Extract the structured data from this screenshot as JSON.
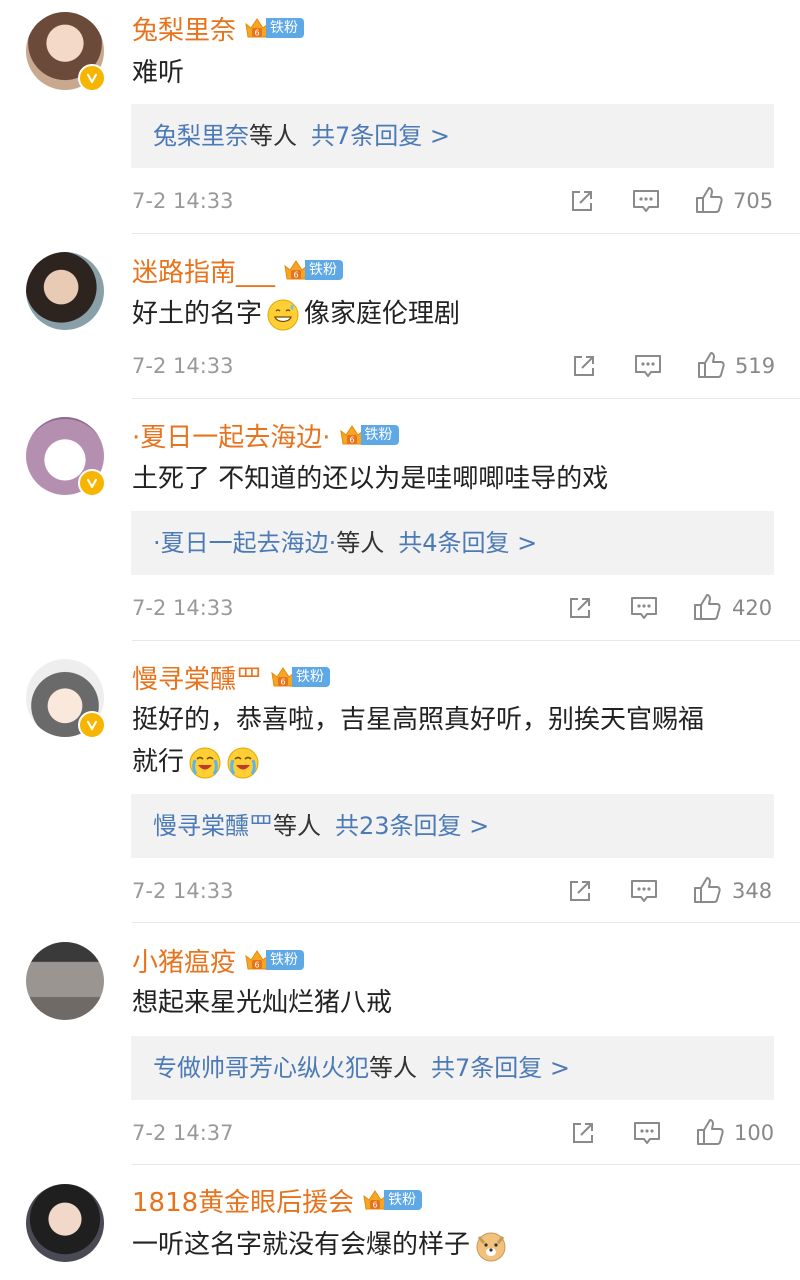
{
  "comments": [
    {
      "user": "兔梨里奈",
      "fan_tag": "铁粉",
      "text": "难听",
      "reply_names": "兔梨里奈",
      "reply_deng": "等人",
      "reply_count": "共7条回复 >",
      "time": "7-2 14:33",
      "likes": "705"
    },
    {
      "user": "迷路指南___",
      "fan_tag": "铁粉",
      "text_a": "好土的名字",
      "text_b": "像家庭伦理剧",
      "time": "7-2 14:33",
      "likes": "519"
    },
    {
      "user": "·夏日一起去海边·",
      "fan_tag": "铁粉",
      "text": "土死了 不知道的还以为是哇唧唧哇导的戏",
      "reply_names": "·夏日一起去海边·",
      "reply_deng": "等人",
      "reply_count": "共4条回复 >",
      "time": "7-2 14:33",
      "likes": "420"
    },
    {
      "user": "慢寻棠醺罒",
      "fan_tag": "铁粉",
      "text_line1": "挺好的，恭喜啦，吉星高照真好听，别挨天官赐福",
      "text_line2": "就行",
      "reply_names": "慢寻棠醺罒",
      "reply_deng": "等人",
      "reply_count": "共23条回复 >",
      "time": "7-2 14:33",
      "likes": "348"
    },
    {
      "user": "小猪瘟疫",
      "fan_tag": "铁粉",
      "text": "想起来星光灿烂猪八戒",
      "reply_names": "专做帅哥芳心纵火犯",
      "reply_deng": "等人",
      "reply_count": "共7条回复 >",
      "time": "7-2 14:37",
      "likes": "100"
    },
    {
      "user": "1818黄金眼后援会",
      "fan_tag": "铁粉",
      "text": "一听这名字就没有会爆的样子"
    }
  ],
  "icons": {
    "repost": "share-icon",
    "comment": "comment-icon",
    "like": "thumb-up-icon",
    "verified": "verified-badge-icon",
    "crown": "fan-crown-icon"
  },
  "colors": {
    "username": "#e8731d",
    "reply_link": "#4c7ab6",
    "fan_tag": "#5fa8e6",
    "verified": "#f7b500",
    "meta": "#999999"
  }
}
